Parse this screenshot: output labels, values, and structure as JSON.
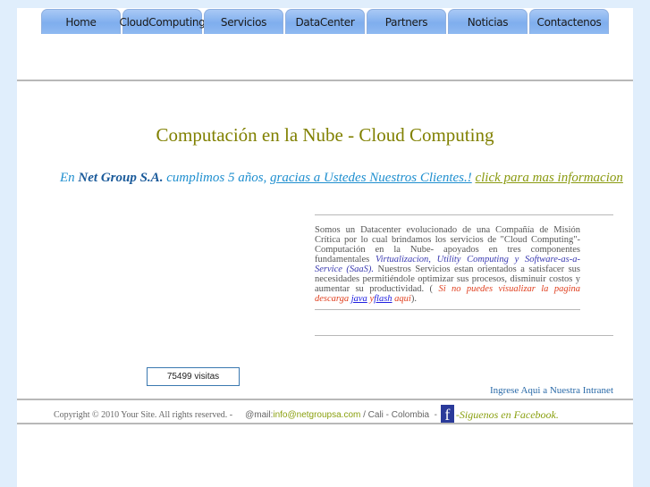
{
  "nav": {
    "items": [
      "Home",
      "CloudComputing",
      "Servicios",
      "DataCenter",
      "Partners",
      "Noticias",
      "Contactenos"
    ]
  },
  "title": "Computación en la Nube  -  Cloud Computing",
  "promo": {
    "prefix": "En ",
    "company": "Net Group S.A.",
    "middle": " cumplimos 5 años, ",
    "thanks_link": "gracias a Ustedes Nuestros Clientes.!",
    "more_link": "click para mas informacion"
  },
  "about": {
    "p1": "Somos un Datacenter evolucionado de una Compañía de Misión Crítica por lo cual brindamos los servicios de \"Cloud Computing\"- Computación en la Nube- apoyados en tres componentes fundamentales ",
    "components": "Virtualizacion, Utility Computing y Software-as-a-Service (SaaS).",
    "p2": " Nuestros Servicios estan orientados a satisfacer sus necesidades permitiéndole optimizar sus procesos, disminuir costos y aumentar su productividad. ( ",
    "download_note": "Si no puedes visualizar la pagina descarga ",
    "java_link": "java",
    "and": " y",
    "flash_link": "flash",
    "here": " aqui",
    "close": ")."
  },
  "counter": "75499 visitas",
  "intranet_link": "Ingrese Aqui a Nuestra Intranet",
  "footer": {
    "copyright": "Copyright © 2010 Your Site. All rights reserved. -",
    "mail_label": "@mail: ",
    "email": "info@netgroupsa.com",
    "location": " / Cali - Colombia  -",
    "fb_glyph": "f",
    "facebook": "-Siguenos en Facebook."
  }
}
